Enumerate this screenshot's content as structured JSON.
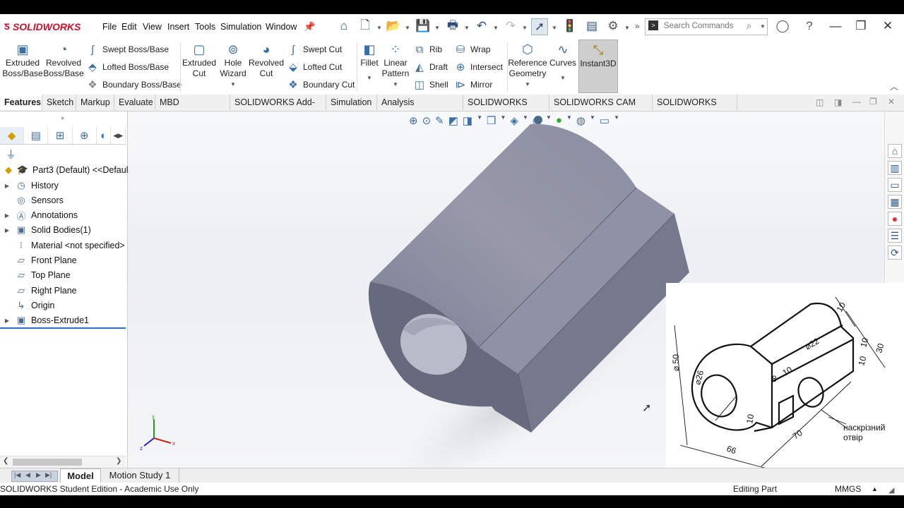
{
  "app": {
    "brand": "SOLIDWORKS",
    "brand_color": "#c8102e"
  },
  "menu": [
    "File",
    "Edit",
    "View",
    "Insert",
    "Tools",
    "Simulation",
    "Window"
  ],
  "search": {
    "placeholder": "Search Commands"
  },
  "command_manager": {
    "features_big": [
      {
        "label": "Extruded\nBoss/Base",
        "icon": "extruded-boss-icon"
      },
      {
        "label": "Revolved\nBoss/Base",
        "icon": "revolved-boss-icon"
      }
    ],
    "features_small_1": [
      "Swept Boss/Base",
      "Lofted Boss/Base",
      "Boundary Boss/Base"
    ],
    "cut_big": [
      {
        "label": "Extruded\nCut"
      },
      {
        "label": "Hole\nWizard"
      },
      {
        "label": "Revolved\nCut"
      }
    ],
    "cut_small": [
      "Swept Cut",
      "Lofted Cut",
      "Boundary Cut"
    ],
    "fillet": {
      "label": "Fillet"
    },
    "linear_pattern": {
      "label": "Linear\nPattern"
    },
    "modify_small_1": [
      "Rib",
      "Draft",
      "Shell"
    ],
    "modify_small_2": [
      "Wrap",
      "Intersect",
      "Mirror"
    ],
    "reference_geometry": {
      "label": "Reference\nGeometry"
    },
    "curves": {
      "label": "Curves"
    },
    "instant3d": {
      "label": "Instant3D"
    }
  },
  "tabs": [
    "Features",
    "Sketch",
    "Markup",
    "Evaluate",
    "MBD Dimensions",
    "SOLIDWORKS Add-Ins",
    "Simulation",
    "Analysis Preparation",
    "SOLIDWORKS CAM",
    "SOLIDWORKS CAM TBM",
    "SOLIDWORKS PDM"
  ],
  "feature_tree": {
    "root": "Part3 (Default) <<Defaul",
    "items": [
      "History",
      "Sensors",
      "Annotations",
      "Solid Bodies(1)",
      "Material <not specified>",
      "Front Plane",
      "Top Plane",
      "Right Plane",
      "Origin",
      "Boss-Extrude1"
    ]
  },
  "drawing": {
    "dims": [
      "10",
      "10",
      "10",
      "30",
      "⌀ 50",
      "⌀22",
      "⌀26",
      "8",
      "10",
      "10",
      "70",
      "66"
    ],
    "note_line1": "наскрізний",
    "note_line2": "отвір"
  },
  "bottom_tabs": [
    "Model",
    "Motion Study 1"
  ],
  "status": {
    "left": "SOLIDWORKS Student Edition - Academic Use Only",
    "mode": "Editing Part",
    "units": "MMGS"
  },
  "triad": {
    "x": "x",
    "y": "y",
    "z": "z"
  }
}
